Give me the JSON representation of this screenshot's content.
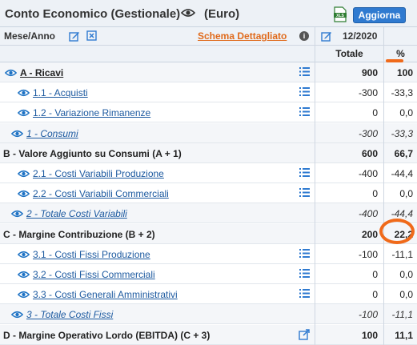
{
  "header": {
    "title": "Conto Economico (Gestionale)",
    "currency": "(Euro)",
    "refresh_label": "Aggiorna",
    "export_icon": "xls-file-icon"
  },
  "columns": {
    "period_label": "Mese/Anno",
    "schema_link": "Schema Dettagliato",
    "info_label": "i",
    "period_value": "12/2020",
    "total_header": "Totale",
    "percent_header": "%"
  },
  "rows": [
    {
      "label": "A - Ricavi",
      "total": "900",
      "percent": "100",
      "style": "section-link",
      "list_icon": true
    },
    {
      "label": "1.1 - Acquisti",
      "total": "-300",
      "percent": "-33,3",
      "style": "detail",
      "list_icon": true
    },
    {
      "label": "1.2 - Variazione Rimanenze",
      "total": "0",
      "percent": "0,0",
      "style": "detail",
      "list_icon": true
    },
    {
      "label": "1 - Consumi",
      "total": "-300",
      "percent": "-33,3",
      "style": "subtotal"
    },
    {
      "label": "B - Valore Aggiunto su Consumi (A + 1)",
      "total": "600",
      "percent": "66,7",
      "style": "section"
    },
    {
      "label": "2.1 - Costi Variabili Produzione",
      "total": "-400",
      "percent": "-44,4",
      "style": "detail",
      "list_icon": true
    },
    {
      "label": "2.2 - Costi Variabili Commerciali",
      "total": "0",
      "percent": "0,0",
      "style": "detail",
      "list_icon": true
    },
    {
      "label": "2 - Totale Costi Variabili",
      "total": "-400",
      "percent": "-44,4",
      "style": "subtotal"
    },
    {
      "label": "C - Margine Contribuzione (B + 2)",
      "total": "200",
      "percent": "22,2",
      "style": "section"
    },
    {
      "label": "3.1 - Costi Fissi Produzione",
      "total": "-100",
      "percent": "-11,1",
      "style": "detail",
      "list_icon": true
    },
    {
      "label": "3.2 - Costi Fissi Commerciali",
      "total": "0",
      "percent": "0,0",
      "style": "detail",
      "list_icon": true
    },
    {
      "label": "3.3 - Costi Generali Amministrativi",
      "total": "0",
      "percent": "0,0",
      "style": "detail",
      "list_icon": true
    },
    {
      "label": "3 - Totale Costi Fissi",
      "total": "-100",
      "percent": "-11,1",
      "style": "subtotal"
    },
    {
      "label": "D - Margine Operativo Lordo (EBITDA) (C + 3)",
      "total": "100",
      "percent": "11,1",
      "style": "section",
      "ext_icon": true
    }
  ],
  "colors": {
    "accent_orange": "#f06a1a",
    "link_blue": "#1d5aa0",
    "button_blue": "#2f7ad0",
    "header_bg": "#edf1f6"
  }
}
